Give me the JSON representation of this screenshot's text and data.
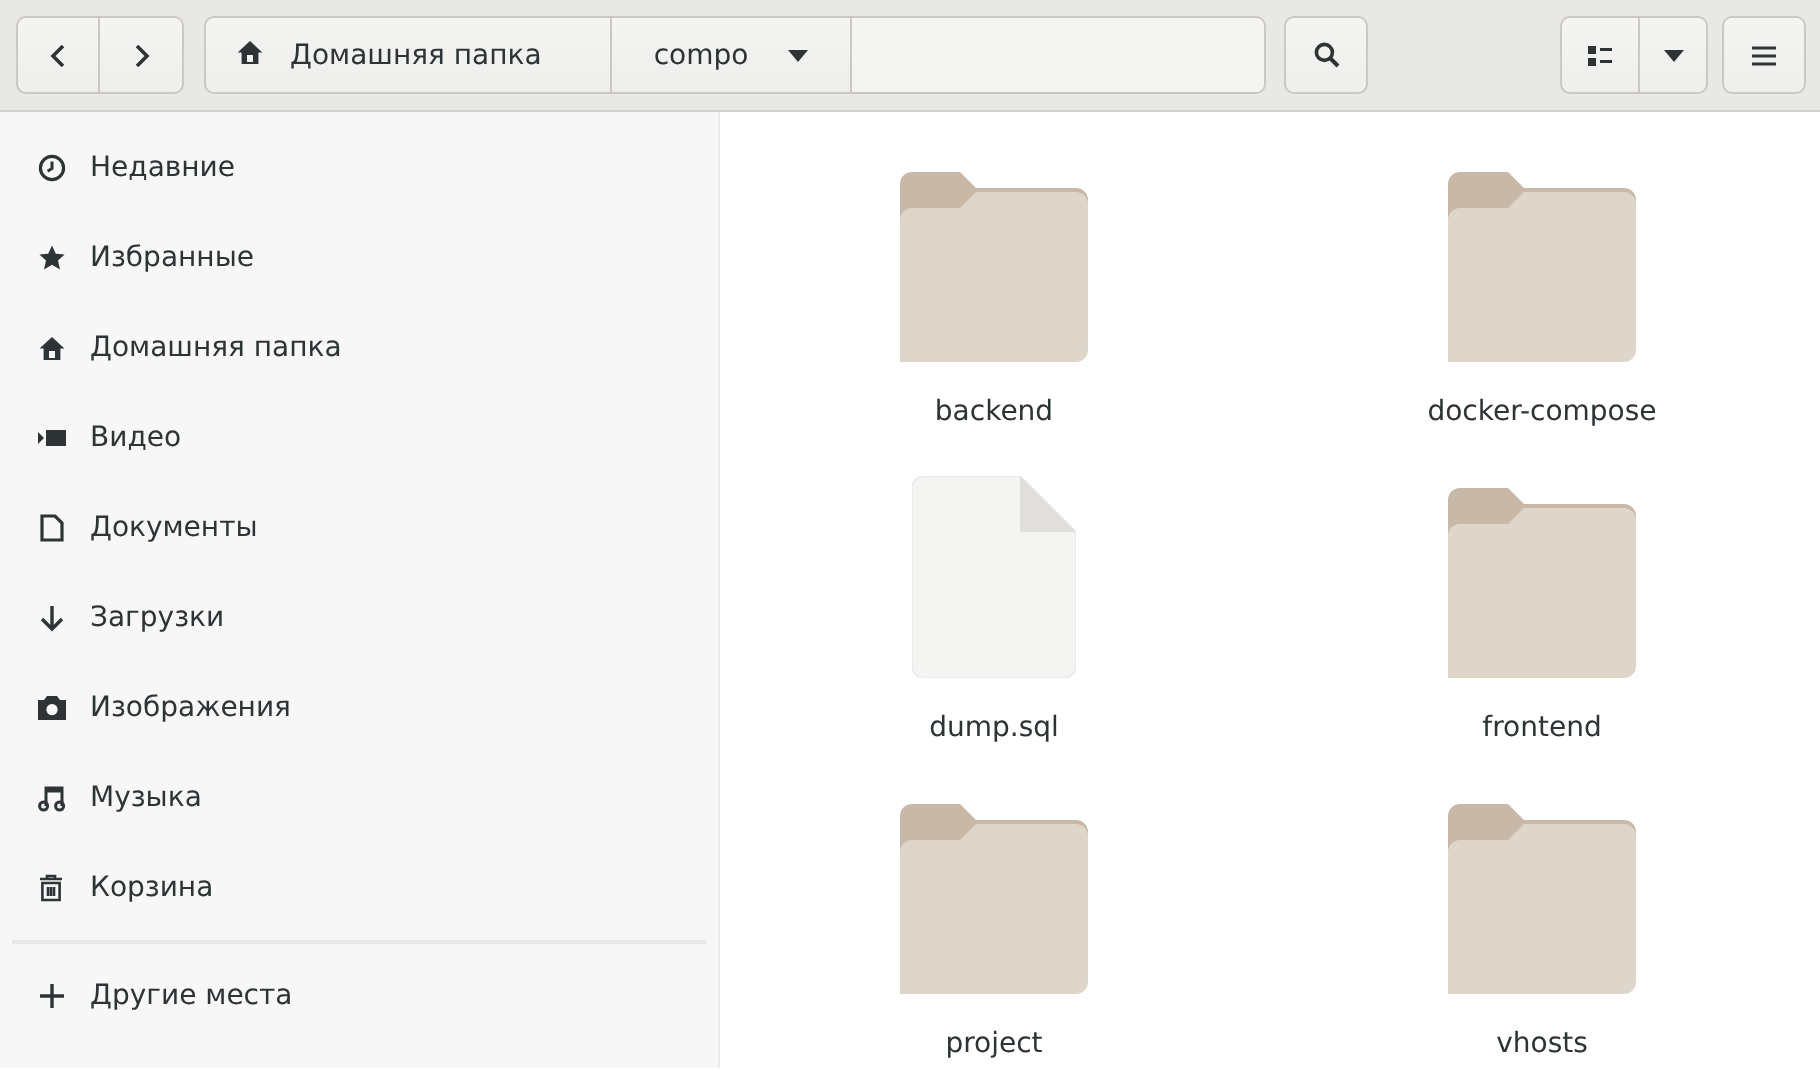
{
  "header": {
    "path": [
      {
        "kind": "home",
        "label": "Домашняя папка"
      },
      {
        "kind": "current",
        "label": "compo"
      }
    ]
  },
  "sidebar": {
    "items": [
      {
        "kind": "recent",
        "label": "Недавние"
      },
      {
        "kind": "starred",
        "label": "Избранные"
      },
      {
        "kind": "home",
        "label": "Домашняя папка"
      },
      {
        "kind": "videos",
        "label": "Видео"
      },
      {
        "kind": "documents",
        "label": "Документы"
      },
      {
        "kind": "downloads",
        "label": "Загрузки"
      },
      {
        "kind": "pictures",
        "label": "Изображения"
      },
      {
        "kind": "music",
        "label": "Музыка"
      },
      {
        "kind": "trash",
        "label": "Корзина"
      }
    ],
    "other": {
      "kind": "other",
      "label": "Другие места"
    }
  },
  "files": [
    {
      "kind": "folder",
      "name": "backend"
    },
    {
      "kind": "folder",
      "name": "docker-compose"
    },
    {
      "kind": "file",
      "name": "dump.sql"
    },
    {
      "kind": "folder",
      "name": "frontend"
    },
    {
      "kind": "folder",
      "name": "project"
    },
    {
      "kind": "folder",
      "name": "vhosts"
    }
  ]
}
